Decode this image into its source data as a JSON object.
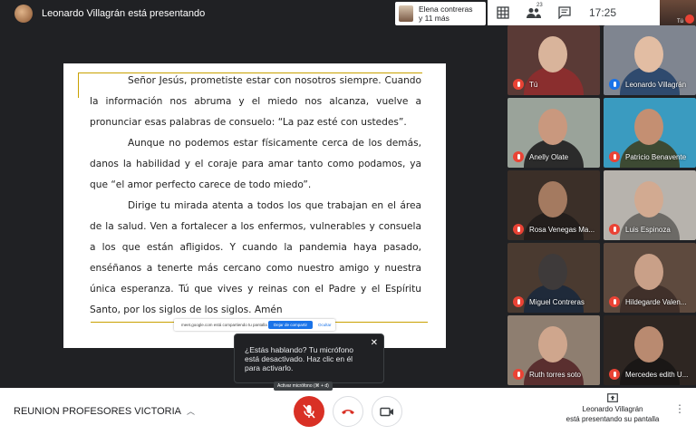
{
  "header": {
    "presenting_title": "Leonardo Villagrán está presentando",
    "others_line1": "Elena contreras",
    "others_line2": "y 11 más",
    "participant_count": "23",
    "clock": "17:25",
    "self_label": "Tú"
  },
  "document": {
    "paragraphs": [
      "Señor Jesús, prometiste estar con nosotros siempre. Cuando la información nos abruma y el miedo nos alcanza, vuelve a pronunciar esas palabras de consuelo: “La paz esté con ustedes”.",
      "Aunque no podemos estar físicamente cerca de los demás, danos la habilidad y el coraje para amar tanto como podamos, ya que “el amor perfecto carece de todo miedo”.",
      "Dirige tu mirada atenta a todos los que trabajan en el área de la salud. Ven a fortalecer a los enfermos, vulnerables y consuela a los que están afligidos.  Y cuando la pandemia haya pasado, enséñanos a tenerte más cercano como nuestro amigo y nuestra única esperanza. Tú que vives y reinas con el Padre y el Espíritu Santo, por los siglos de los siglos. Amén"
    ],
    "share_bar_text": "meet.google.com está compartiendo tu pantalla",
    "share_bar_stop": "Dejar de compartir",
    "share_bar_hide": "Ocultar"
  },
  "tooltip": {
    "text": "¿Estás hablando? Tu micrófono está desactivado. Haz clic en él para activarlo."
  },
  "participants": [
    {
      "name": "Tú",
      "bg": "#5a3a36",
      "face": "#d9b49b",
      "body": "#8a2e2e",
      "speaking": false
    },
    {
      "name": "Leonardo Villagrán",
      "bg": "#7f8590",
      "face": "#e2bda3",
      "body": "#2f4a6e",
      "speaking": true
    },
    {
      "name": "Anelly Olate",
      "bg": "#9aa39a",
      "face": "#c9987e",
      "body": "#2b2b2b",
      "speaking": false
    },
    {
      "name": "Patricio Benavente",
      "bg": "#3a9bc0",
      "face": "#c48f72",
      "body": "#3d4a33",
      "speaking": false
    },
    {
      "name": "Rosa Venegas Ma...",
      "bg": "#3b2f28",
      "face": "#a47a60",
      "body": "#231e1c",
      "speaking": false
    },
    {
      "name": "Luis Espinoza",
      "bg": "#b7b3ad",
      "face": "#d2aa91",
      "body": "#6c6a66",
      "speaking": false
    },
    {
      "name": "Miguel Contreras",
      "bg": "#4a3a30",
      "face": "#3e3a3a",
      "body": "#1f2a3a",
      "speaking": false
    },
    {
      "name": "Hildegarde Valen...",
      "bg": "#5e4a3e",
      "face": "#c9a088",
      "body": "#40302a",
      "speaking": false
    },
    {
      "name": "Ruth torres soto",
      "bg": "#8e7e70",
      "face": "#cfa68d",
      "body": "#5a2f2f",
      "speaking": false
    },
    {
      "name": "Mercedes edith U...",
      "bg": "#2e2622",
      "face": "#b98a70",
      "body": "#1a1716",
      "speaking": false
    }
  ],
  "bottom": {
    "meeting_name": "REUNION PROFESORES VICTORIA",
    "mic_tooltip": "Activar micrófono (⌘ + d)",
    "present_line1": "Leonardo Villagrán",
    "present_line2": "está presentando su pantalla"
  },
  "colors": {
    "accent": "#1a73e8",
    "danger": "#d93025",
    "doc_rule": "#c9a100"
  }
}
